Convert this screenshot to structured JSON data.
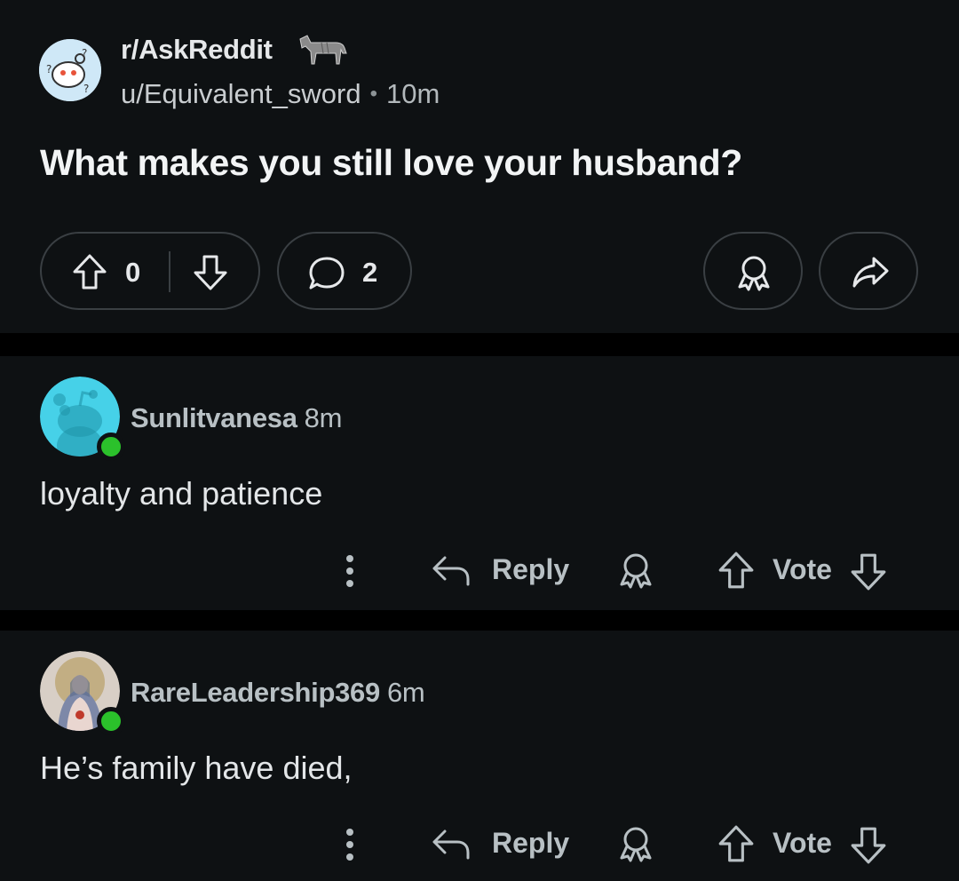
{
  "post": {
    "subreddit": "r/AskReddit",
    "author": "u/Equivalent_sword",
    "separator": "•",
    "time": "10m",
    "title": "What makes you still love your husband?",
    "upvotes": "0",
    "comment_count": "2"
  },
  "comments": [
    {
      "author": "Sunlitvanesa",
      "time": "8m",
      "body": "loyalty and patience",
      "online": true,
      "actions": {
        "reply": "Reply",
        "vote": "Vote"
      }
    },
    {
      "author": "RareLeadership369",
      "time": "6m",
      "body": "He’s family have died,",
      "online": true,
      "actions": {
        "reply": "Reply",
        "vote": "Vote"
      }
    }
  ],
  "colors": {
    "background": "#000000",
    "card": "#0e1113",
    "border": "#3a3f43",
    "online": "#2bc12b",
    "snoo_avatar": "#46d1e8"
  },
  "icons": [
    "upvote-icon",
    "downvote-icon",
    "comment-icon",
    "award-icon",
    "share-icon",
    "more-icon",
    "reply-icon"
  ]
}
